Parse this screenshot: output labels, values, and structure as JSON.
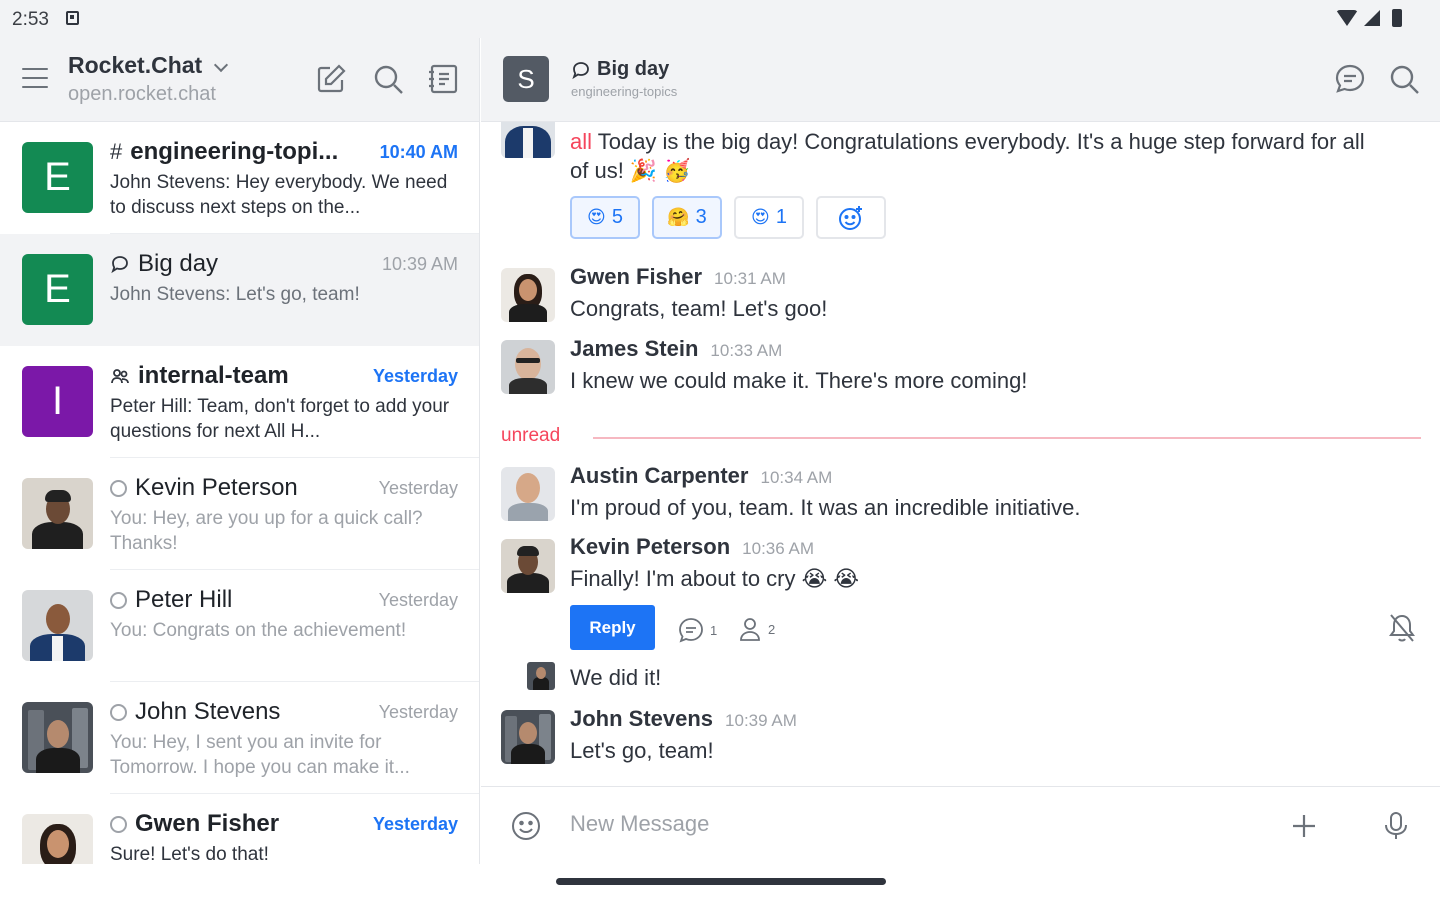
{
  "status_bar": {
    "time": "2:53"
  },
  "sidebar": {
    "workspace_name": "Rocket.Chat",
    "workspace_host": "open.rocket.chat",
    "rooms": [
      {
        "avatar_letter": "E",
        "avatar_color": "#138a53",
        "type": "channel",
        "name": "engineering-topi...",
        "time": "10:40 AM",
        "time_highlight": true,
        "preview": "John Stevens: Hey everybody. We need to discuss next steps on the..."
      },
      {
        "avatar_letter": "E",
        "avatar_color": "#138a53",
        "type": "discussion",
        "name": "Big day",
        "time": "10:39 AM",
        "time_highlight": false,
        "preview": "John Stevens: Let's go, team!"
      },
      {
        "avatar_letter": "I",
        "avatar_color": "#7b18a8",
        "type": "team",
        "name": "internal-team",
        "time": "Yesterday",
        "time_highlight": true,
        "preview": "Peter Hill: Team, don't forget to add your questions for next All H..."
      },
      {
        "type": "dm",
        "name": "Kevin Peterson",
        "time": "Yesterday",
        "time_highlight": false,
        "preview": "You: Hey, are you up for a quick call? Thanks!"
      },
      {
        "type": "dm",
        "name": "Peter Hill",
        "time": "Yesterday",
        "time_highlight": false,
        "preview": "You: Congrats on the achievement!"
      },
      {
        "type": "dm",
        "name": "John Stevens",
        "time": "Yesterday",
        "time_highlight": false,
        "preview": "You: Hey, I sent you an invite for Tomorrow. I hope you can make it..."
      },
      {
        "type": "dm",
        "name": "Gwen Fisher",
        "time": "Yesterday",
        "time_highlight": true,
        "preview": "Sure! Let's do that!"
      }
    ]
  },
  "room": {
    "avatar_letter": "S",
    "name": "Big day",
    "parent": "engineering-topics"
  },
  "messages": {
    "first": {
      "mention": "all",
      "text": " Today is the big day! Congratulations everybody. It's a huge step forward for all of us! 🎉 🥳"
    },
    "reactions": [
      {
        "emoji": "😍",
        "count": "5",
        "mine": true
      },
      {
        "emoji": "🤗",
        "count": "3",
        "mine": true
      },
      {
        "emoji": "😍",
        "count": "1",
        "mine": false
      }
    ],
    "gwen": {
      "author": "Gwen Fisher",
      "time": "10:31 AM",
      "text": "Congrats, team! Let's goo!"
    },
    "james": {
      "author": "James Stein",
      "time": "10:33 AM",
      "text": "I knew we could make it. There's more coming!"
    },
    "unread_label": "unread",
    "austin": {
      "author": "Austin Carpenter",
      "time": "10:34 AM",
      "text": "I'm proud of you, team. It was an incredible initiative."
    },
    "kevin": {
      "author": "Kevin Peterson",
      "time": "10:36 AM",
      "text": "Finally! I'm about to cry 😭 😭"
    },
    "thread": {
      "reply_label": "Reply",
      "replies": "1",
      "participants": "2"
    },
    "we_did": {
      "text": "We did it!"
    },
    "john": {
      "author": "John Stevens",
      "time": "10:39 AM",
      "text": "Let's go, team!"
    }
  },
  "composer": {
    "placeholder": "New Message"
  }
}
